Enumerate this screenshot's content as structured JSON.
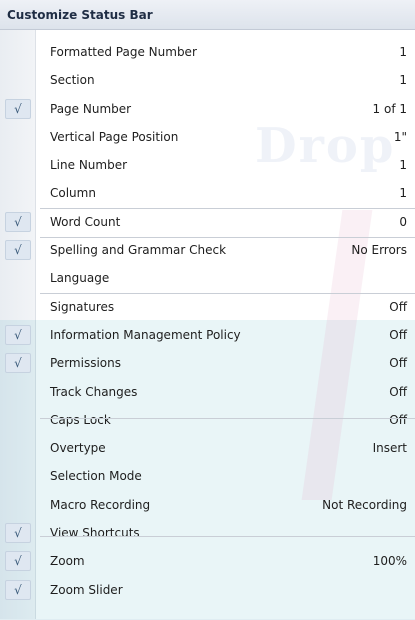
{
  "menu": {
    "title": "Customize Status Bar",
    "items": [
      {
        "label": "Formatted Page Number",
        "value": "1",
        "checked": false
      },
      {
        "label": "Section",
        "value": "1",
        "checked": false
      },
      {
        "label": "Page Number",
        "value": "1 of 1",
        "checked": true
      },
      {
        "label": "Vertical Page Position",
        "value": "1\"",
        "checked": false
      },
      {
        "label": "Line Number",
        "value": "1",
        "checked": false
      },
      {
        "label": "Column",
        "value": "1",
        "checked": false
      },
      {
        "label": "Word Count",
        "value": "0",
        "checked": true
      },
      {
        "label": "Spelling and Grammar Check",
        "value": "No Errors",
        "checked": true
      },
      {
        "label": "Language",
        "value": "",
        "checked": false
      },
      {
        "label": "Signatures",
        "value": "Off",
        "checked": false
      },
      {
        "label": "Information Management Policy",
        "value": "Off",
        "checked": true
      },
      {
        "label": "Permissions",
        "value": "Off",
        "checked": true
      },
      {
        "label": "Track Changes",
        "value": "Off",
        "checked": false
      },
      {
        "label": "Caps Lock",
        "value": "Off",
        "checked": false
      },
      {
        "label": "Overtype",
        "value": "Insert",
        "checked": false
      },
      {
        "label": "Selection Mode",
        "value": "",
        "checked": false
      },
      {
        "label": "Macro Recording",
        "value": "Not Recording",
        "checked": false
      },
      {
        "label": "View Shortcuts",
        "value": "",
        "checked": true
      },
      {
        "label": "Zoom",
        "value": "100%",
        "checked": true
      },
      {
        "label": "Zoom Slider",
        "value": "",
        "checked": true
      }
    ],
    "check_glyph": "√"
  },
  "watermark": {
    "text": "Drop"
  },
  "colors": {
    "gutter": "#e9edf2",
    "check_bg": "#dfe7f1",
    "title_bg": "#dde3ec"
  }
}
